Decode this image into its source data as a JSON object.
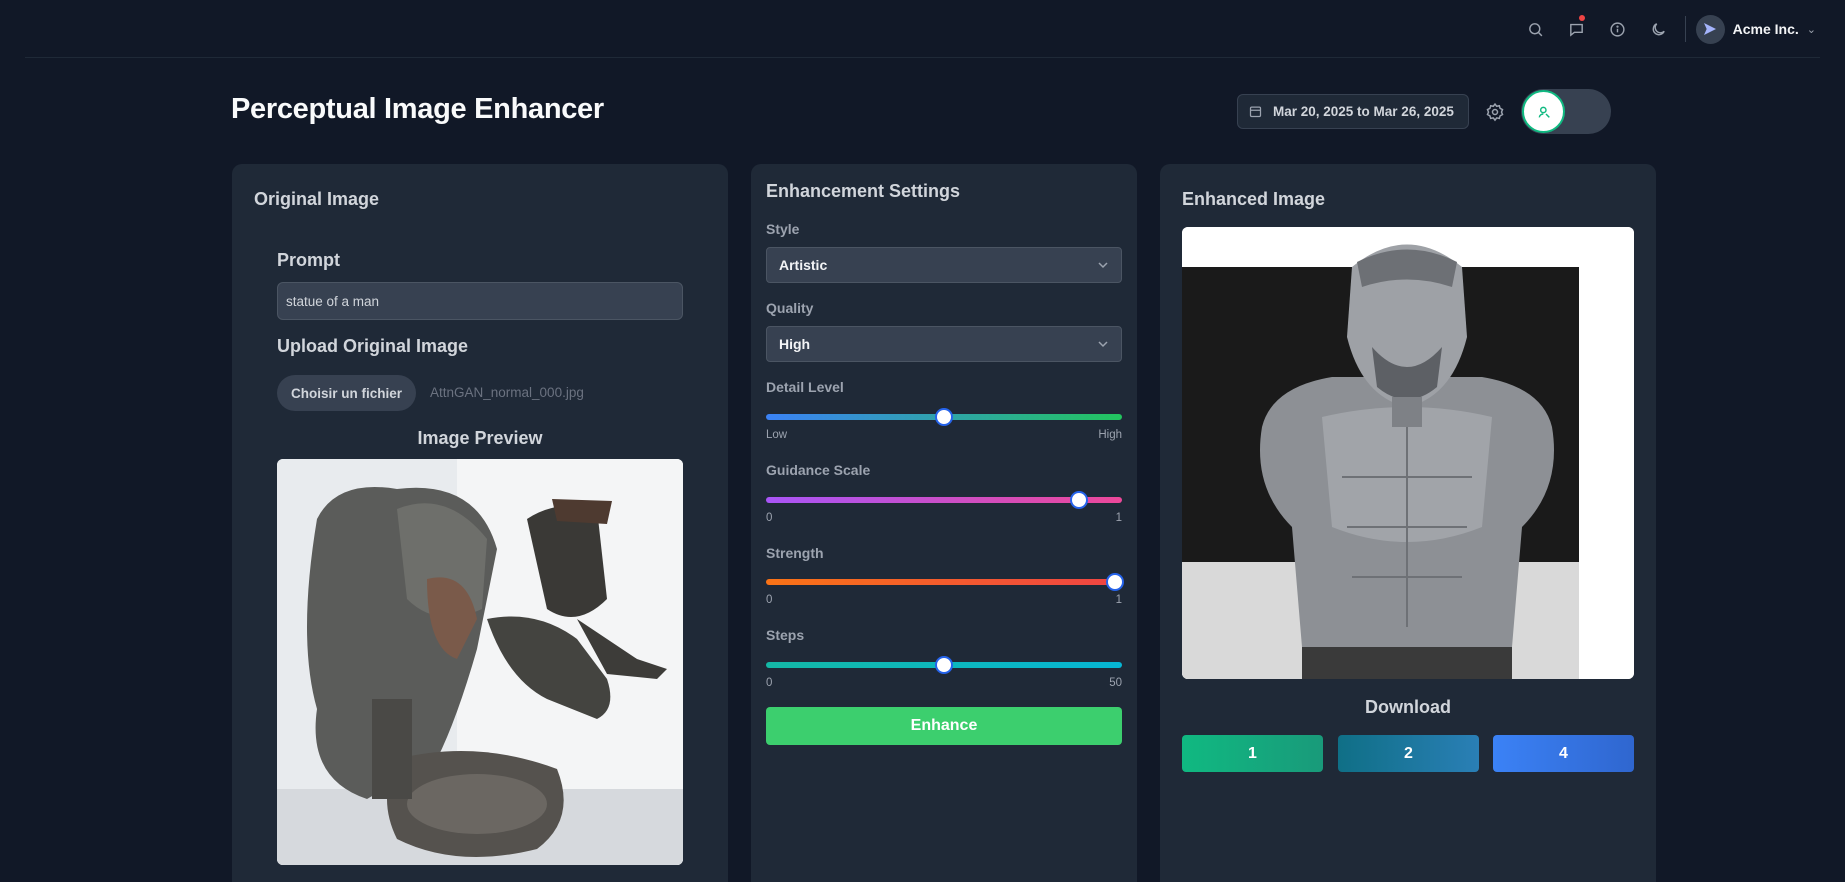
{
  "header": {
    "org_name": "Acme Inc.",
    "icons": [
      "search-icon",
      "chat-notification-icon",
      "info-icon",
      "moon-icon"
    ]
  },
  "page": {
    "title": "Perceptual Image Enhancer",
    "date_range": "Mar 20, 2025 to Mar 26, 2025"
  },
  "original": {
    "title": "Original Image",
    "prompt_label": "Prompt",
    "prompt_value": "statue of a man",
    "upload_label": "Upload Original Image",
    "file_button": "Choisir un fichier",
    "file_name": "AttnGAN_normal_000.jpg",
    "preview_label": "Image Preview"
  },
  "settings": {
    "title": "Enhancement Settings",
    "style_label": "Style",
    "style_value": "Artistic",
    "quality_label": "Quality",
    "quality_value": "High",
    "detail": {
      "label": "Detail Level",
      "min": "Low",
      "max": "High",
      "value": 0.5
    },
    "guidance": {
      "label": "Guidance Scale",
      "min": "0",
      "max": "1",
      "value": 0.88
    },
    "strength": {
      "label": "Strength",
      "min": "0",
      "max": "1",
      "value": 0.98
    },
    "steps": {
      "label": "Steps",
      "min": "0",
      "max": "50",
      "value": 25
    },
    "enhance_button": "Enhance"
  },
  "enhanced": {
    "title": "Enhanced Image",
    "download_label": "Download",
    "download_buttons": [
      "1",
      "2",
      "4"
    ]
  },
  "colors": {
    "background": "#111827",
    "card": "#1f2937",
    "accent_green": "#3ccf6e"
  }
}
